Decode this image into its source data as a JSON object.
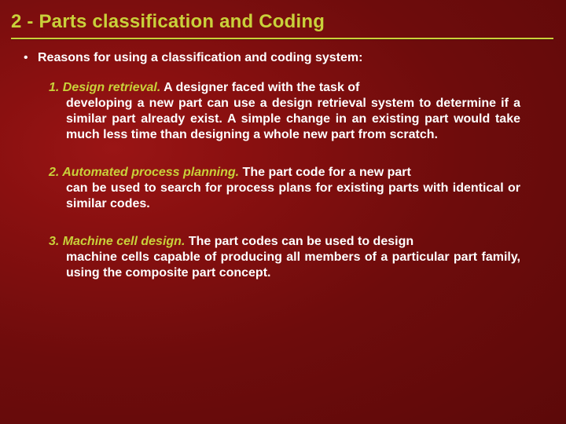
{
  "title": "2 - Parts classification and Coding",
  "bullet": {
    "marker": "•",
    "text": "Reasons for using a classification and coding system:"
  },
  "items": [
    {
      "lead": "1. Design retrieval.",
      "first_tail": " A designer faced with the task of",
      "rest": "developing a new part can use a design retrieval system to determine if a similar part already exist. A simple change in an existing part would take much less time than designing a whole new part from scratch."
    },
    {
      "lead": "2. Automated process planning.",
      "first_tail": " The part code for a new part",
      "rest": "can be used to search for process plans for existing parts with identical or similar codes."
    },
    {
      "lead": "3. Machine cell design.",
      "first_tail": " The part codes can be used to design",
      "rest": "machine cells capable of producing all members of a particular part family, using the composite part concept."
    }
  ]
}
